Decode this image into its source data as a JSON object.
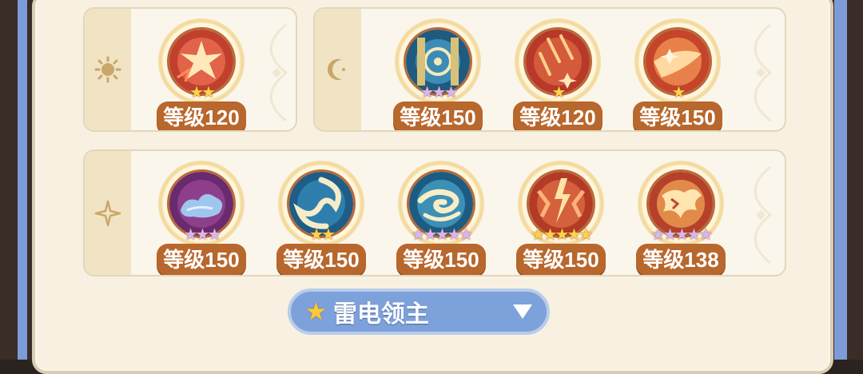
{
  "groups": [
    {
      "tab_icon": "sun-icon",
      "skills": [
        {
          "level": "等级120",
          "stars": "★★",
          "star_color": "gold",
          "theme": "red-star"
        }
      ]
    },
    {
      "tab_icon": "moon-icon",
      "skills": [
        {
          "level": "等级150",
          "stars": "★★★",
          "star_color": "purple",
          "theme": "blue-clock"
        },
        {
          "level": "等级120",
          "stars": "★",
          "star_color": "gold",
          "theme": "red-meteor"
        },
        {
          "level": "等级150",
          "stars": "★",
          "star_color": "gold",
          "theme": "orange-explosion"
        }
      ]
    },
    {
      "tab_icon": "sparkle-icon",
      "skills": [
        {
          "level": "等级150",
          "stars": "★★★",
          "star_color": "purple",
          "theme": "purple-cloud"
        },
        {
          "level": "等级150",
          "stars": "★★",
          "star_color": "gold",
          "theme": "blue-swirl"
        },
        {
          "level": "等级150",
          "stars": "★★★★★",
          "star_color": "purple",
          "theme": "blue-vortex"
        },
        {
          "level": "等级150",
          "stars": "★★★★★",
          "star_color": "gold",
          "theme": "red-lightning"
        },
        {
          "level": "等级138",
          "stars": "★★★★★",
          "star_color": "purple",
          "theme": "red-burst"
        }
      ]
    }
  ],
  "dropdown": {
    "icon": "star-icon",
    "label": "雷电领主",
    "arrow": "triangle-down-icon"
  }
}
